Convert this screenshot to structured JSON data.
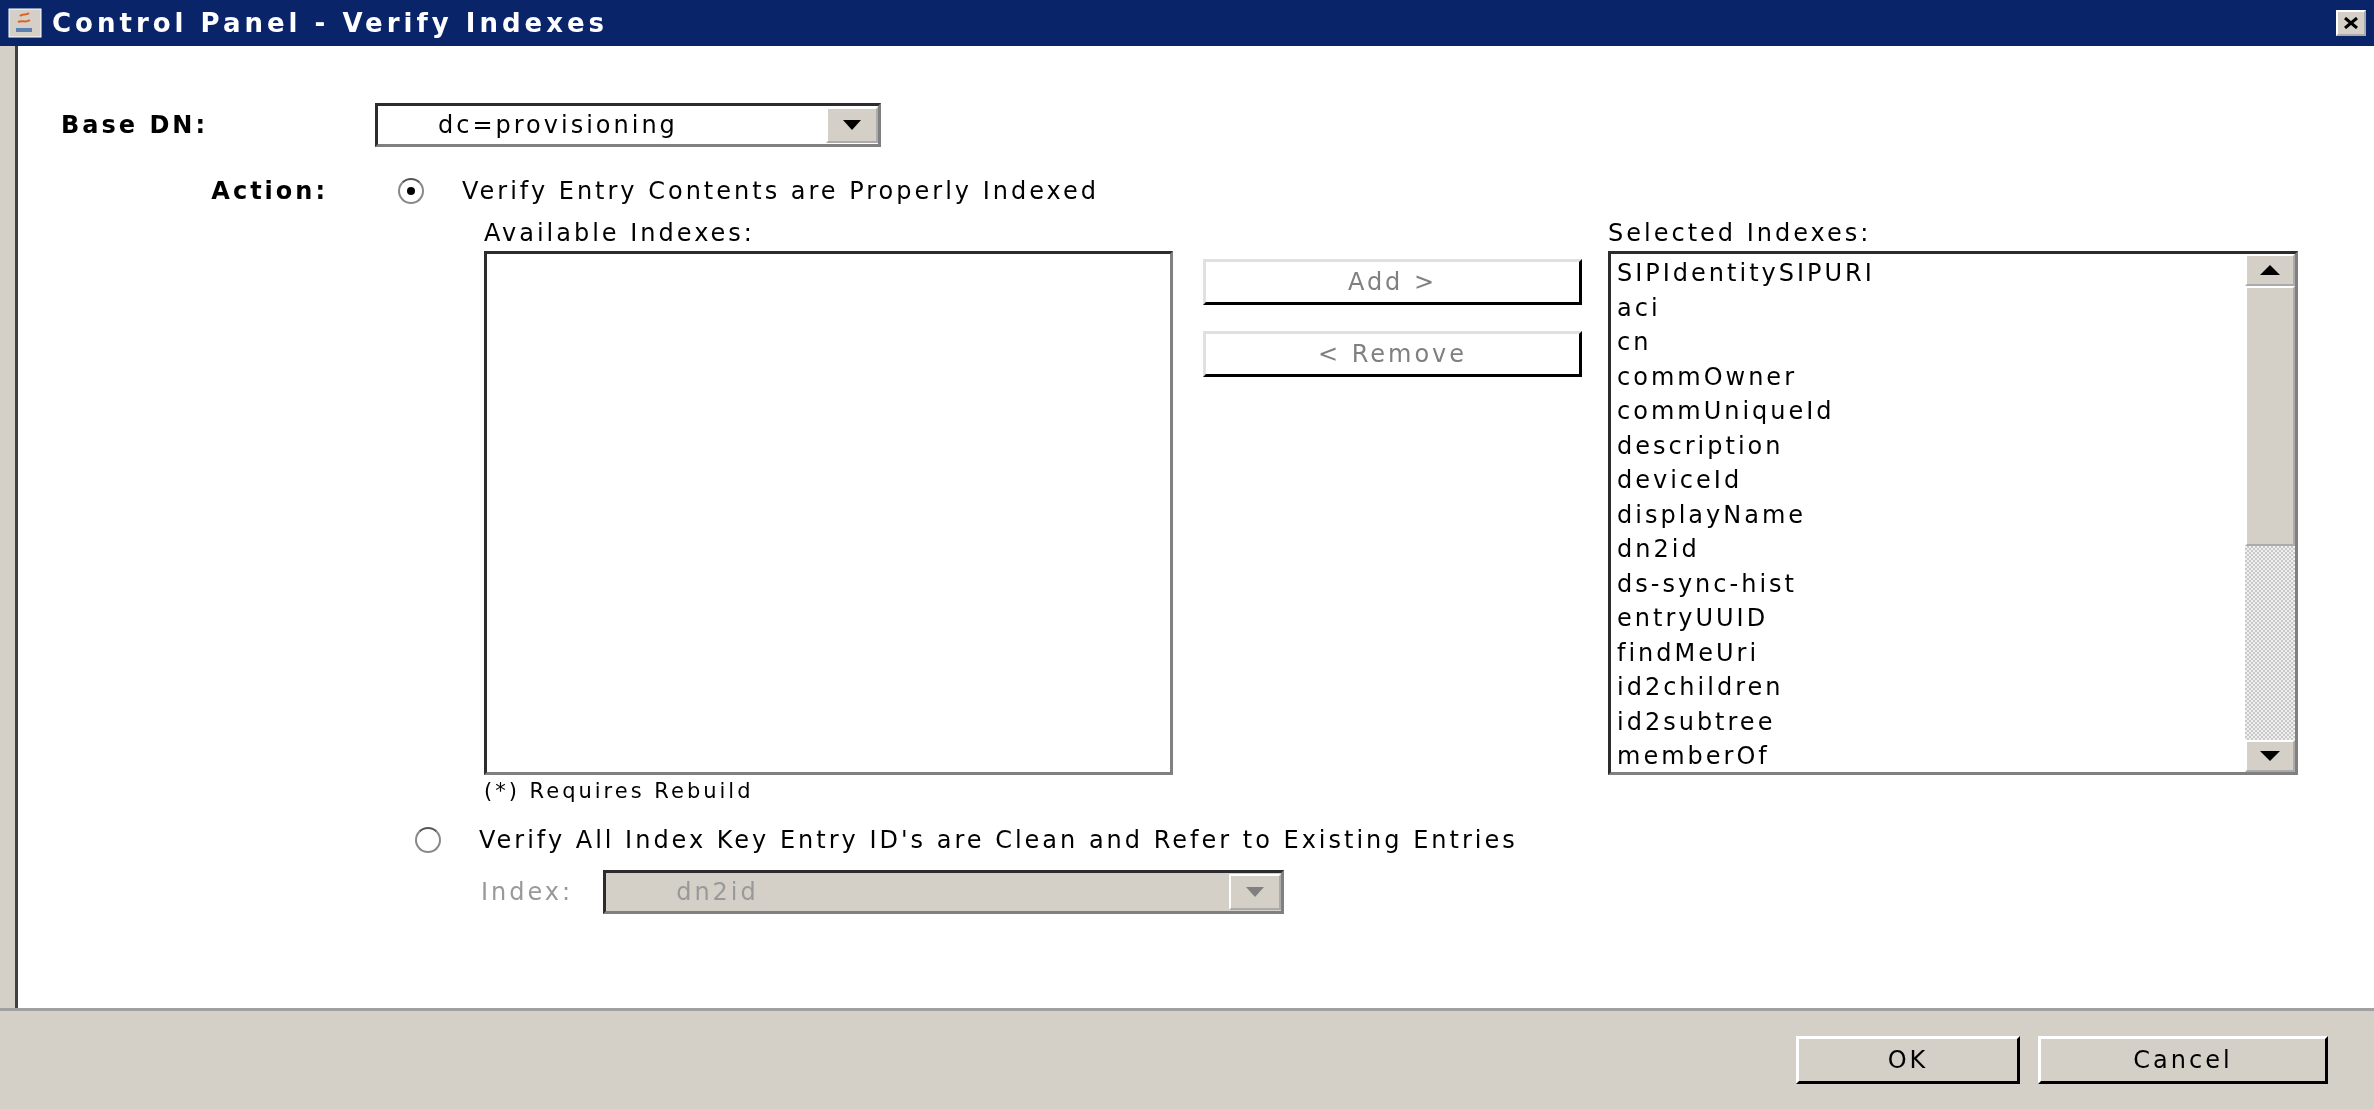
{
  "window": {
    "title": "Control Panel - Verify Indexes"
  },
  "base_dn": {
    "label": "Base DN:",
    "value": "dc=provisioning"
  },
  "action": {
    "label": "Action:",
    "options": [
      {
        "label": "Verify Entry Contents are Properly Indexed",
        "selected": true
      },
      {
        "label": "Verify All Index Key Entry ID's are Clean and Refer to Existing Entries",
        "selected": false
      }
    ]
  },
  "available_indexes": {
    "label": "Available Indexes:"
  },
  "add_button": {
    "label": "Add >",
    "disabled": true
  },
  "remove_button": {
    "label": "< Remove",
    "disabled": true
  },
  "selected_indexes": {
    "label": "Selected Indexes:",
    "items": [
      "SIPIdentitySIPURI",
      "aci",
      "cn",
      "commOwner",
      "commUniqueId",
      "description",
      "deviceId",
      "displayName",
      "dn2id",
      "ds-sync-hist",
      "entryUUID",
      "findMeUri",
      "id2children",
      "id2subtree",
      "memberOf"
    ]
  },
  "note": "(*) Requires Rebuild",
  "index_field": {
    "label": "Index:",
    "value": "dn2id",
    "disabled": true
  },
  "buttons": [
    "OK",
    "Cancel"
  ]
}
